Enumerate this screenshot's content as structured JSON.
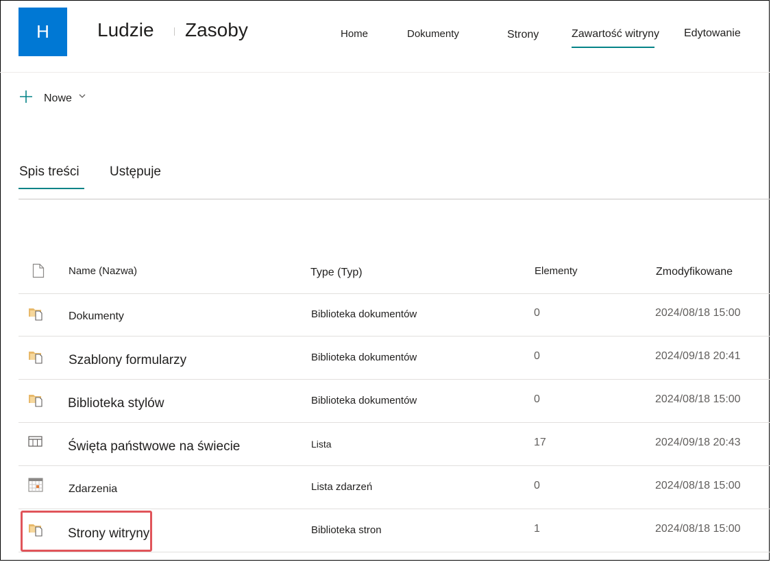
{
  "header": {
    "logo_letter": "H",
    "title_primary": "Ludzie",
    "title_secondary": "Zasoby",
    "nav": [
      "Home",
      "Dokumenty",
      "Strony",
      "Zawartość witryny",
      "Edytowanie"
    ],
    "active_nav": "Zawartość witryny",
    "accent_color": "#038387",
    "logo_color": "#0078d4"
  },
  "command_bar": {
    "new_label": "Nowe",
    "plus_icon": "plus-icon",
    "chevron_icon": "chevron-down-icon"
  },
  "pivot": {
    "tabs": [
      "Spis treści",
      "Ustępuje"
    ],
    "active": "Spis treści"
  },
  "list": {
    "columns": {
      "name": "Name (Nazwa)",
      "type": "Type (Typ)",
      "items": "Elementy",
      "modified": "Zmodyfikowane"
    },
    "rows": [
      {
        "icon": "document-library-icon",
        "name": "Dokumenty",
        "type": "Biblioteka dokumentów",
        "items": "0",
        "modified": "2024/08/18 15:00"
      },
      {
        "icon": "document-library-icon",
        "name": "Szablony formularzy",
        "type": "Biblioteka dokumentów",
        "items": "0",
        "modified": "2024/09/18 20:41"
      },
      {
        "icon": "document-library-icon",
        "name": "Biblioteka stylów",
        "type": "Biblioteka dokumentów",
        "items": "0",
        "modified": "2024/08/18 15:00"
      },
      {
        "icon": "list-icon",
        "name": "Święta państwowe na świecie",
        "type": "Lista",
        "items": "17",
        "modified": "2024/09/18 20:43"
      },
      {
        "icon": "calendar-icon",
        "name": "Zdarzenia",
        "type": "Lista zdarzeń",
        "items": "0",
        "modified": "2024/08/18 15:00"
      },
      {
        "icon": "document-library-icon",
        "name": "Strony witryny",
        "type": "Biblioteka stron",
        "items": "1",
        "modified": "2024/08/18 15:00"
      }
    ],
    "highlighted_row": "Strony witryny",
    "highlight_color": "#e0545a"
  }
}
